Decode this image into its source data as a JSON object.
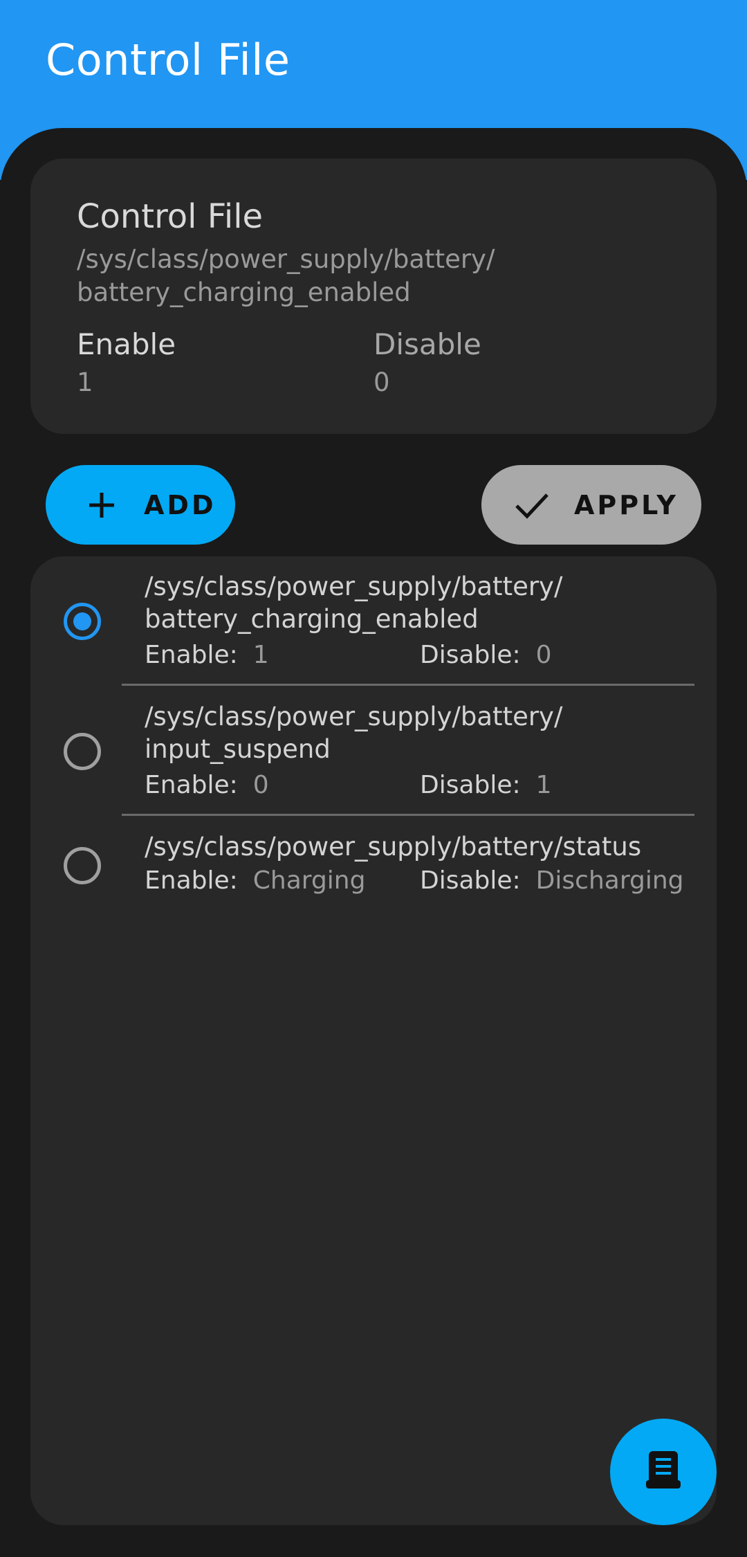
{
  "app_bar": {
    "title": "Control File"
  },
  "current": {
    "title": "Control File",
    "path": "/sys/class/power_supply/battery/ battery_charging_enabled",
    "enable_label": "Enable",
    "enable_value": "1",
    "disable_label": "Disable",
    "disable_value": "0"
  },
  "actions": {
    "add_label": "ADD",
    "apply_label": "APPLY"
  },
  "list": {
    "enable_key": "Enable:",
    "disable_key": "Disable:",
    "items": [
      {
        "path": "/sys/class/power_supply/battery/ battery_charging_enabled",
        "enable": "1",
        "disable": "0",
        "selected": true
      },
      {
        "path": "/sys/class/power_supply/battery/ input_suspend",
        "enable": "0",
        "disable": "1",
        "selected": false
      },
      {
        "path": "/sys/class/power_supply/battery/status",
        "enable": "Charging",
        "disable": "Discharging",
        "selected": false
      }
    ]
  },
  "fab": {
    "icon": "document-icon"
  },
  "colors": {
    "accent": "#2196f3",
    "button_accent": "#03a9f4",
    "apply_button": "#a9a9a9",
    "background": "#1a1a1a",
    "card": "#282828"
  }
}
